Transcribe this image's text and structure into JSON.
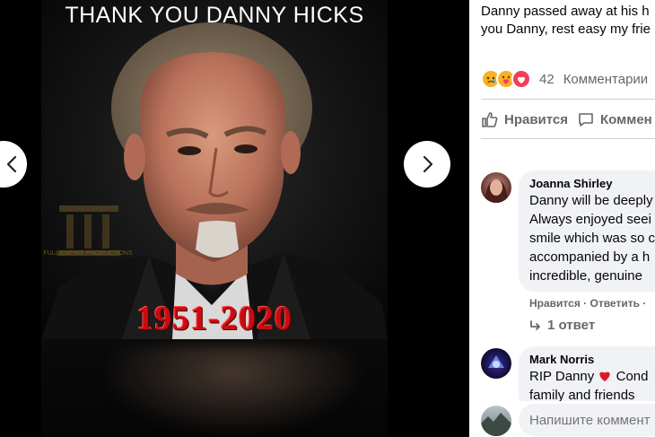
{
  "photo": {
    "title": "THANK YOU DANNY HICKS",
    "dates": "1951-2020",
    "watermark": "FULL EMPIRE PRODUCTIONS"
  },
  "post": {
    "text_line1": "Danny passed away at his h",
    "text_line2": "you Danny, rest easy my frie"
  },
  "reactions": {
    "icons": [
      "sad-reaction-icon",
      "care-reaction-icon",
      "love-reaction-icon"
    ],
    "count": "42",
    "comments_label": "Комментарии"
  },
  "actions": {
    "like": "Нравится",
    "comment": "Коммен"
  },
  "comments": [
    {
      "name": "Joanna Shirley",
      "lines": [
        "Danny will be deeply",
        "Always enjoyed seei",
        "smile which was so c",
        "accompanied by a h",
        "incredible, genuine"
      ],
      "like": "Нравится",
      "reply": "Ответить",
      "replies": "1 ответ"
    },
    {
      "name": "Mark Norris",
      "line1_before": "RIP Danny",
      "line1_after": "Cond",
      "line2": "family and friends"
    }
  ],
  "composer": {
    "placeholder": "Напишите коммент"
  },
  "colors": {
    "love_red": "#f33e58",
    "dates_red": "#c80c12",
    "link_gray": "#65676b"
  }
}
